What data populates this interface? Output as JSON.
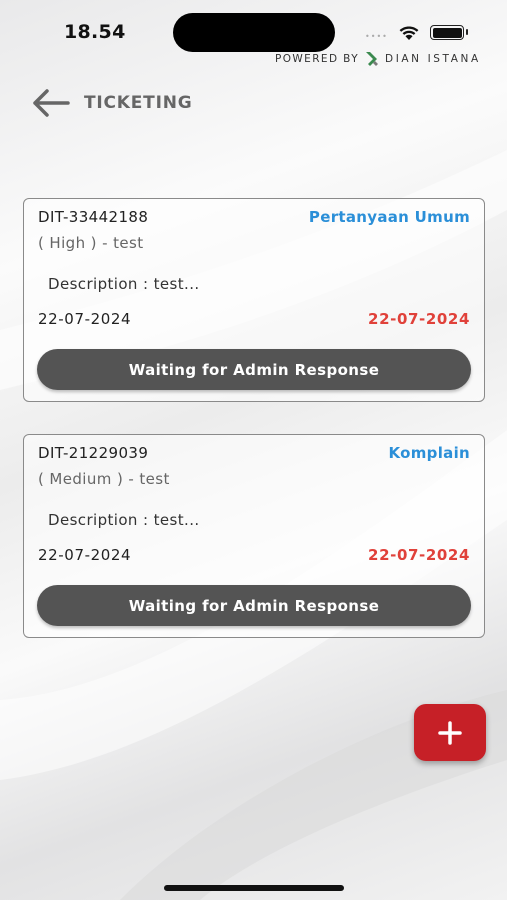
{
  "status_bar": {
    "time": "18.54",
    "signal": "••••"
  },
  "branding": {
    "powered_by": "POWERED BY",
    "brand_name": "DIAN ISTANA",
    "logo_color": "#3b8a4f"
  },
  "header": {
    "title": "TICKETING",
    "back_icon": "arrow-left-icon"
  },
  "tickets": [
    {
      "id": "DIT-33442188",
      "category": "Pertanyaan Umum",
      "priority_subject": "( High ) - test",
      "description": "Description : test...",
      "created_date": "22-07-2024",
      "due_date": "22-07-2024",
      "status": "Waiting for Admin Response"
    },
    {
      "id": "DIT-21229039",
      "category": "Komplain",
      "priority_subject": "( Medium ) - test",
      "description": "Description : test...",
      "created_date": "22-07-2024",
      "due_date": "22-07-2024",
      "status": "Waiting for Admin Response"
    }
  ],
  "fab": {
    "icon": "plus-icon",
    "color": "#c62027"
  },
  "colors": {
    "category": "#2b8fd8",
    "due_date": "#e0413a",
    "status_button": "#545454"
  }
}
